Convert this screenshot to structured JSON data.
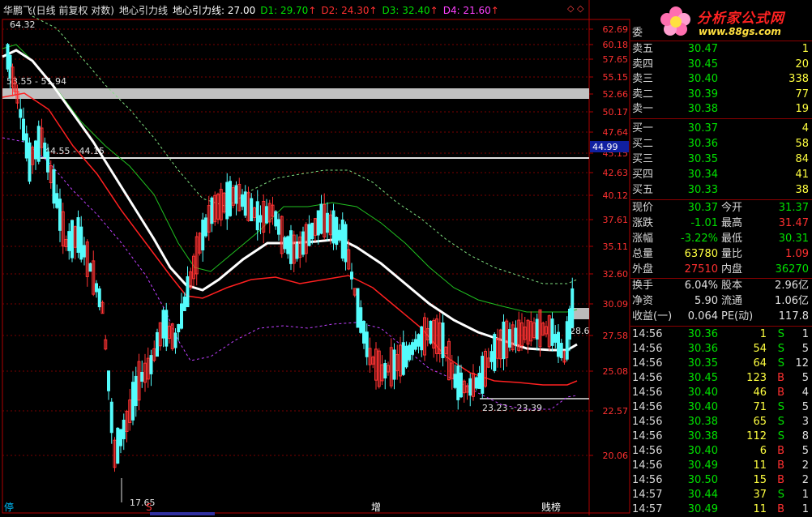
{
  "title": {
    "stock": "华鹏飞(日线 前复权 对数)",
    "indicator": "地心引力线",
    "main_label": "地心引力线: 27.00",
    "d1": "D1: 29.70",
    "d2": "D2: 24.30",
    "d3": "D3: 32.40",
    "d4": "D4: 21.60",
    "arrow": "↑",
    "corner_icons": "◇ ◇"
  },
  "logo": {
    "site": "分析家公式网",
    "url": "www.88gs.com"
  },
  "chart": {
    "price_axis": [
      "62.69",
      "60.18",
      "57.65",
      "55.15",
      "52.66",
      "50.17",
      "47.64",
      "45.15",
      "42.63",
      "40.12",
      "37.61",
      "35.11",
      "32.60",
      "30.09",
      "27.58",
      "25.08",
      "22.57",
      "20.06"
    ],
    "current_price_marker": "44.99",
    "right_value": "28.6",
    "annotations": [
      "64.32",
      "53.55 - 51.94",
      "44.55 - 44.15",
      "23.23 - 23.39",
      "17.65"
    ],
    "bottom_markers": [
      "停",
      "S",
      "增",
      "贱榜"
    ]
  },
  "colors": {
    "up": "#ff3232",
    "down": "#54fcfc",
    "axis": "#b00000",
    "green": "#00e000",
    "red": "#ff3030",
    "yellow": "#ffff40"
  },
  "quote": {
    "wei_label": "委",
    "sell": [
      {
        "label": "卖五",
        "price": "30.47",
        "vol": "1"
      },
      {
        "label": "卖四",
        "price": "30.45",
        "vol": "20"
      },
      {
        "label": "卖三",
        "price": "30.40",
        "vol": "338"
      },
      {
        "label": "卖二",
        "price": "30.39",
        "vol": "77"
      },
      {
        "label": "卖一",
        "price": "30.38",
        "vol": "19"
      }
    ],
    "buy": [
      {
        "label": "买一",
        "price": "30.37",
        "vol": "4"
      },
      {
        "label": "买二",
        "price": "30.36",
        "vol": "58"
      },
      {
        "label": "买三",
        "price": "30.35",
        "vol": "84"
      },
      {
        "label": "买四",
        "price": "30.34",
        "vol": "41"
      },
      {
        "label": "买五",
        "price": "30.33",
        "vol": "38"
      }
    ],
    "stats": [
      {
        "l1": "现价",
        "v1": "30.37",
        "c1": "g",
        "l2": "今开",
        "v2": "31.37",
        "c2": "g"
      },
      {
        "l1": "涨跌",
        "v1": "-1.01",
        "c1": "g",
        "l2": "最高",
        "v2": "31.47",
        "c2": "r"
      },
      {
        "l1": "涨幅",
        "v1": "-3.22%",
        "c1": "g",
        "l2": "最低",
        "v2": "30.31",
        "c2": "g"
      },
      {
        "l1": "总量",
        "v1": "63780",
        "c1": "y",
        "l2": "量比",
        "v2": "1.09",
        "c2": "r"
      },
      {
        "l1": "外盘",
        "v1": "27510",
        "c1": "r",
        "l2": "内盘",
        "v2": "36270",
        "c2": "g"
      }
    ],
    "stats2": [
      {
        "l1": "换手",
        "v1": "6.04%",
        "l2": "股本",
        "v2": "2.96亿"
      },
      {
        "l1": "净资",
        "v1": "5.90",
        "l2": "流通",
        "v2": "1.06亿"
      },
      {
        "l1": "收益(一)",
        "v1": "0.064",
        "l2": "PE(动)",
        "v2": "117.8"
      }
    ],
    "ticks": [
      {
        "t": "14:56",
        "p": "30.36",
        "v": "1",
        "s": "S",
        "n": "1"
      },
      {
        "t": "14:56",
        "p": "30.36",
        "v": "54",
        "s": "S",
        "n": "5"
      },
      {
        "t": "14:56",
        "p": "30.35",
        "v": "64",
        "s": "S",
        "n": "12"
      },
      {
        "t": "14:56",
        "p": "30.45",
        "v": "123",
        "s": "B",
        "n": "5"
      },
      {
        "t": "14:56",
        "p": "30.40",
        "v": "46",
        "s": "B",
        "n": "4"
      },
      {
        "t": "14:56",
        "p": "30.40",
        "v": "71",
        "s": "S",
        "n": "5"
      },
      {
        "t": "14:56",
        "p": "30.38",
        "v": "65",
        "s": "S",
        "n": "3"
      },
      {
        "t": "14:56",
        "p": "30.38",
        "v": "112",
        "s": "S",
        "n": "8"
      },
      {
        "t": "14:56",
        "p": "30.40",
        "v": "6",
        "s": "B",
        "n": "5"
      },
      {
        "t": "14:56",
        "p": "30.49",
        "v": "11",
        "s": "B",
        "n": "2"
      },
      {
        "t": "14:56",
        "p": "30.50",
        "v": "15",
        "s": "B",
        "n": "2"
      },
      {
        "t": "14:57",
        "p": "30.44",
        "v": "37",
        "s": "S",
        "n": "1"
      },
      {
        "t": "14:57",
        "p": "30.49",
        "v": "11",
        "s": "B",
        "n": "1"
      }
    ]
  }
}
